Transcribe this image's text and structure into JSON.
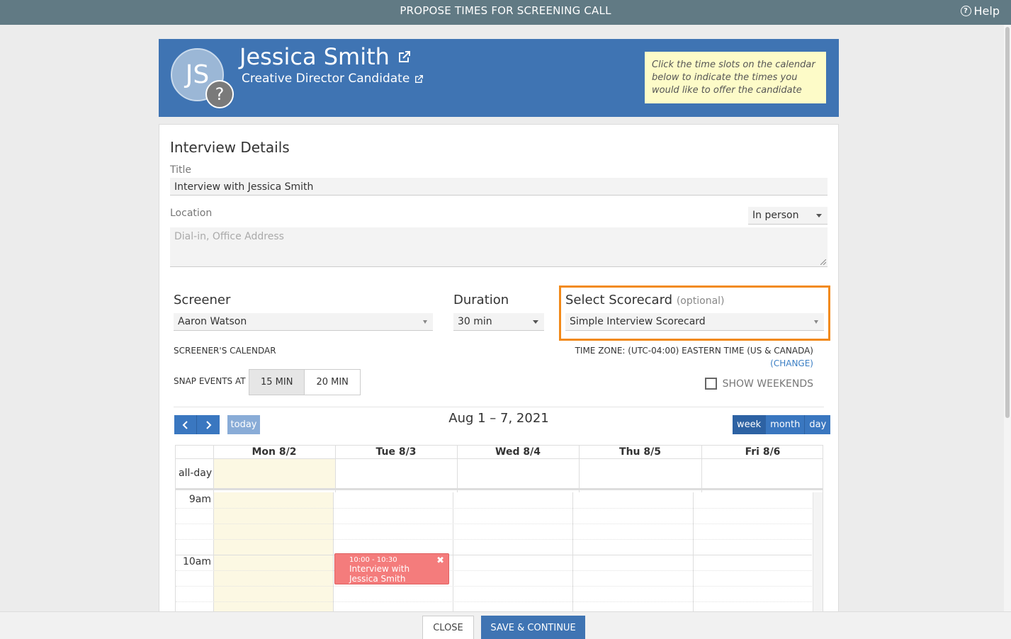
{
  "app": {
    "title": "PROPOSE TIMES FOR SCREENING CALL",
    "help_label": "Help"
  },
  "candidate": {
    "initials": "JS",
    "name": "Jessica Smith",
    "role": "Creative Director Candidate",
    "hint": "Click the time slots on the calendar below to indicate the times you would like to offer the candidate"
  },
  "details": {
    "section_title": "Interview Details",
    "title_label": "Title",
    "title_value": "Interview with Jessica Smith",
    "location_label": "Location",
    "location_type": "In person",
    "location_placeholder": "Dial-in, Office Address"
  },
  "screener": {
    "label": "Screener",
    "value": "Aaron Watson",
    "calendar_label": "SCREENER'S CALENDAR"
  },
  "duration": {
    "label": "Duration",
    "value": "30 min"
  },
  "scorecard": {
    "label": "Select Scorecard",
    "optional": "(optional)",
    "value": "Simple Interview Scorecard"
  },
  "timezone": {
    "text": "TIME ZONE: (UTC-04:00) EASTERN TIME (US & CANADA)",
    "change": "(CHANGE)"
  },
  "snap": {
    "label": "SNAP EVENTS AT",
    "options": [
      "15 MIN",
      "20 MIN"
    ],
    "selected": "15 MIN"
  },
  "weekends": {
    "label": "SHOW WEEKENDS",
    "checked": false
  },
  "calendar": {
    "range": "Aug 1 – 7, 2021",
    "today_label": "today",
    "views": [
      "week",
      "month",
      "day"
    ],
    "active_view": "week",
    "days": [
      "Mon 8/2",
      "Tue 8/3",
      "Wed 8/4",
      "Thu 8/5",
      "Fri 8/6"
    ],
    "allday_label": "all-day",
    "hours": [
      "9am",
      "10am"
    ],
    "event": {
      "time": "10:00 - 10:30",
      "title": "Interview with Jessica Smith",
      "day": "Tue 8/3"
    }
  },
  "footer": {
    "close": "CLOSE",
    "save": "SAVE & CONTINUE"
  },
  "colors": {
    "topbar": "#617a84",
    "header": "#3f74b3",
    "highlight": "#f28a1a",
    "event": "#f47c7c",
    "today_bg": "#fcf8e3"
  }
}
